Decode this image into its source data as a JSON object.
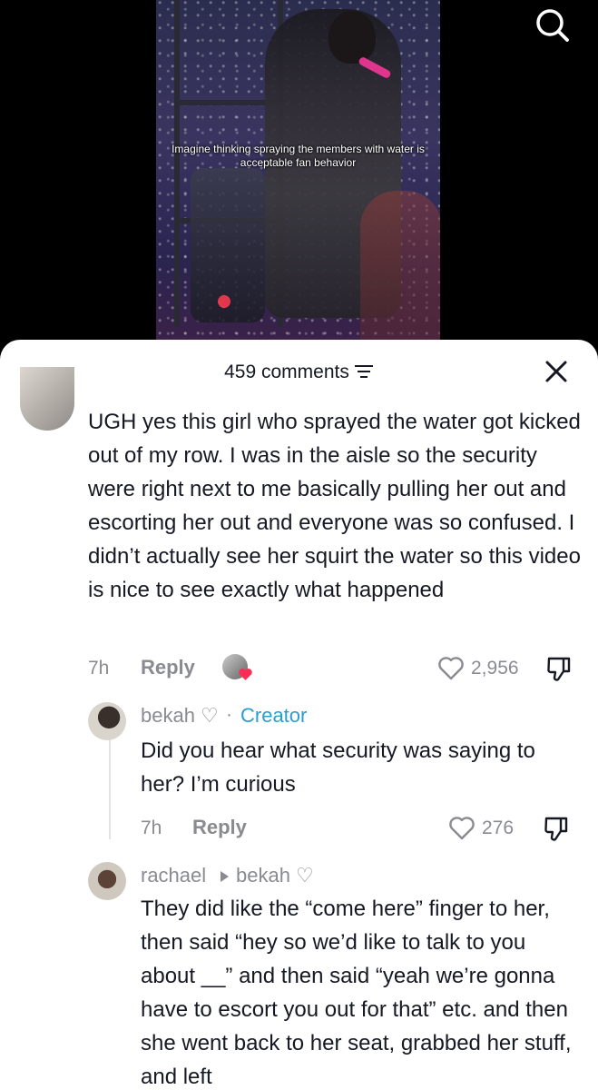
{
  "video": {
    "caption": "Imagine thinking spraying the members with water is acceptable fan behavior",
    "search_icon": "search-icon"
  },
  "sheet": {
    "comment_count_label": "459 comments",
    "filter_icon": "filter-icon",
    "close_icon": "close-icon"
  },
  "comments": [
    {
      "text": "UGH yes this girl who sprayed the water got kicked out of my row. I was in the aisle so the security were right next to me basically pulling her out and escorting her out and everyone was so confused. I didn’t actually see her squirt the water so this video is nice to see exactly what happened",
      "time": "7h",
      "reply_label": "Reply",
      "likes": "2,956"
    },
    {
      "username": "bekah ♡",
      "badge": "Creator",
      "separator": "·",
      "text": "Did you hear what security was saying to her? I’m curious",
      "time": "7h",
      "reply_label": "Reply",
      "likes": "276"
    },
    {
      "username": "rachael",
      "reply_to": "bekah ♡",
      "text": "They did like the “come here” finger to her, then said “hey so we’d like to talk to you about __” and then said “yeah we’re gonna have to escort you out for that” etc. and then she went back to her seat, grabbed her stuff, and left"
    }
  ],
  "colors": {
    "text": "#161823",
    "muted": "#8a8b91",
    "creator_badge": "#2d9ccf",
    "liked_heart": "#fe2c55"
  }
}
